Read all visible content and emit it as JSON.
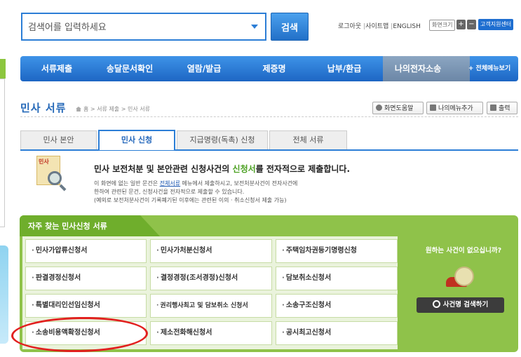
{
  "search": {
    "placeholder": "검색어를 입력하세요",
    "button_label": "검색"
  },
  "utility": {
    "logout": "로그아웃",
    "sitemap": "사이트맵",
    "english": "ENGLISH",
    "font_size_label": "화면크기",
    "plus": "+",
    "minus": "−",
    "help_center": "고객지원센터"
  },
  "nav": {
    "items": [
      "서류제출",
      "송달문서확인",
      "열람/발급",
      "제증명",
      "납부/환급",
      "나의전자소송"
    ],
    "all_menu": "+ 전체메뉴보기",
    "active_index": 5
  },
  "page": {
    "title": "민사 서류",
    "breadcrumb": [
      "홈",
      "서류 제출",
      "민사 서류"
    ],
    "tools": {
      "help": "화면도움말",
      "my_menu": "나의메뉴추가",
      "print": "출력"
    }
  },
  "tabs": [
    "민사 본안",
    "민사 신청",
    "지급명령(독촉) 신청",
    "전체 서류"
  ],
  "intro": {
    "icon_label": "민사",
    "headline_pre": "민사 보전처분 및 본안관련 신청사건의 ",
    "headline_highlight": "신청서",
    "headline_post": "를 전자적으로 제출합니다.",
    "desc1_pre": "이 화면에 없는 일반 문건은 ",
    "desc1_link": "전체서류",
    "desc1_post": " 메뉴에서 제출하시고, 보전처분사건이 전자사건에",
    "desc2": "한하여 관련된 문건, 신청사건을 전자적으로 제출할 수 있습니다.",
    "desc3": "(예외로 보전처분사건이 기록폐기된 이후에는 관련된 이의 · 취소신청서 제출 가능)"
  },
  "panel": {
    "title": "자주 찾는 민사신청 서류",
    "bullet": "·",
    "forms": [
      [
        "민사가압류신청서",
        "민사가처분신청서",
        "주택임차권등기명령신청"
      ],
      [
        "판결경정신청서",
        "결정경정(조서경정)신청서",
        "담보취소신청서"
      ],
      [
        "특별대리인선임신청서",
        "권리행사최고 및 담보취소 신청서",
        "소송구조신청서"
      ],
      [
        "소송비용액확정신청서",
        "제소전화해신청서",
        "공시최고신청서"
      ]
    ],
    "side_question": "원하는 사건이 없으십니까?",
    "side_button": "사건명 검색하기"
  },
  "colors": {
    "primary_blue": "#2c7ed6",
    "panel_green": "#8fc24a",
    "annotation_red": "#e2201f"
  }
}
